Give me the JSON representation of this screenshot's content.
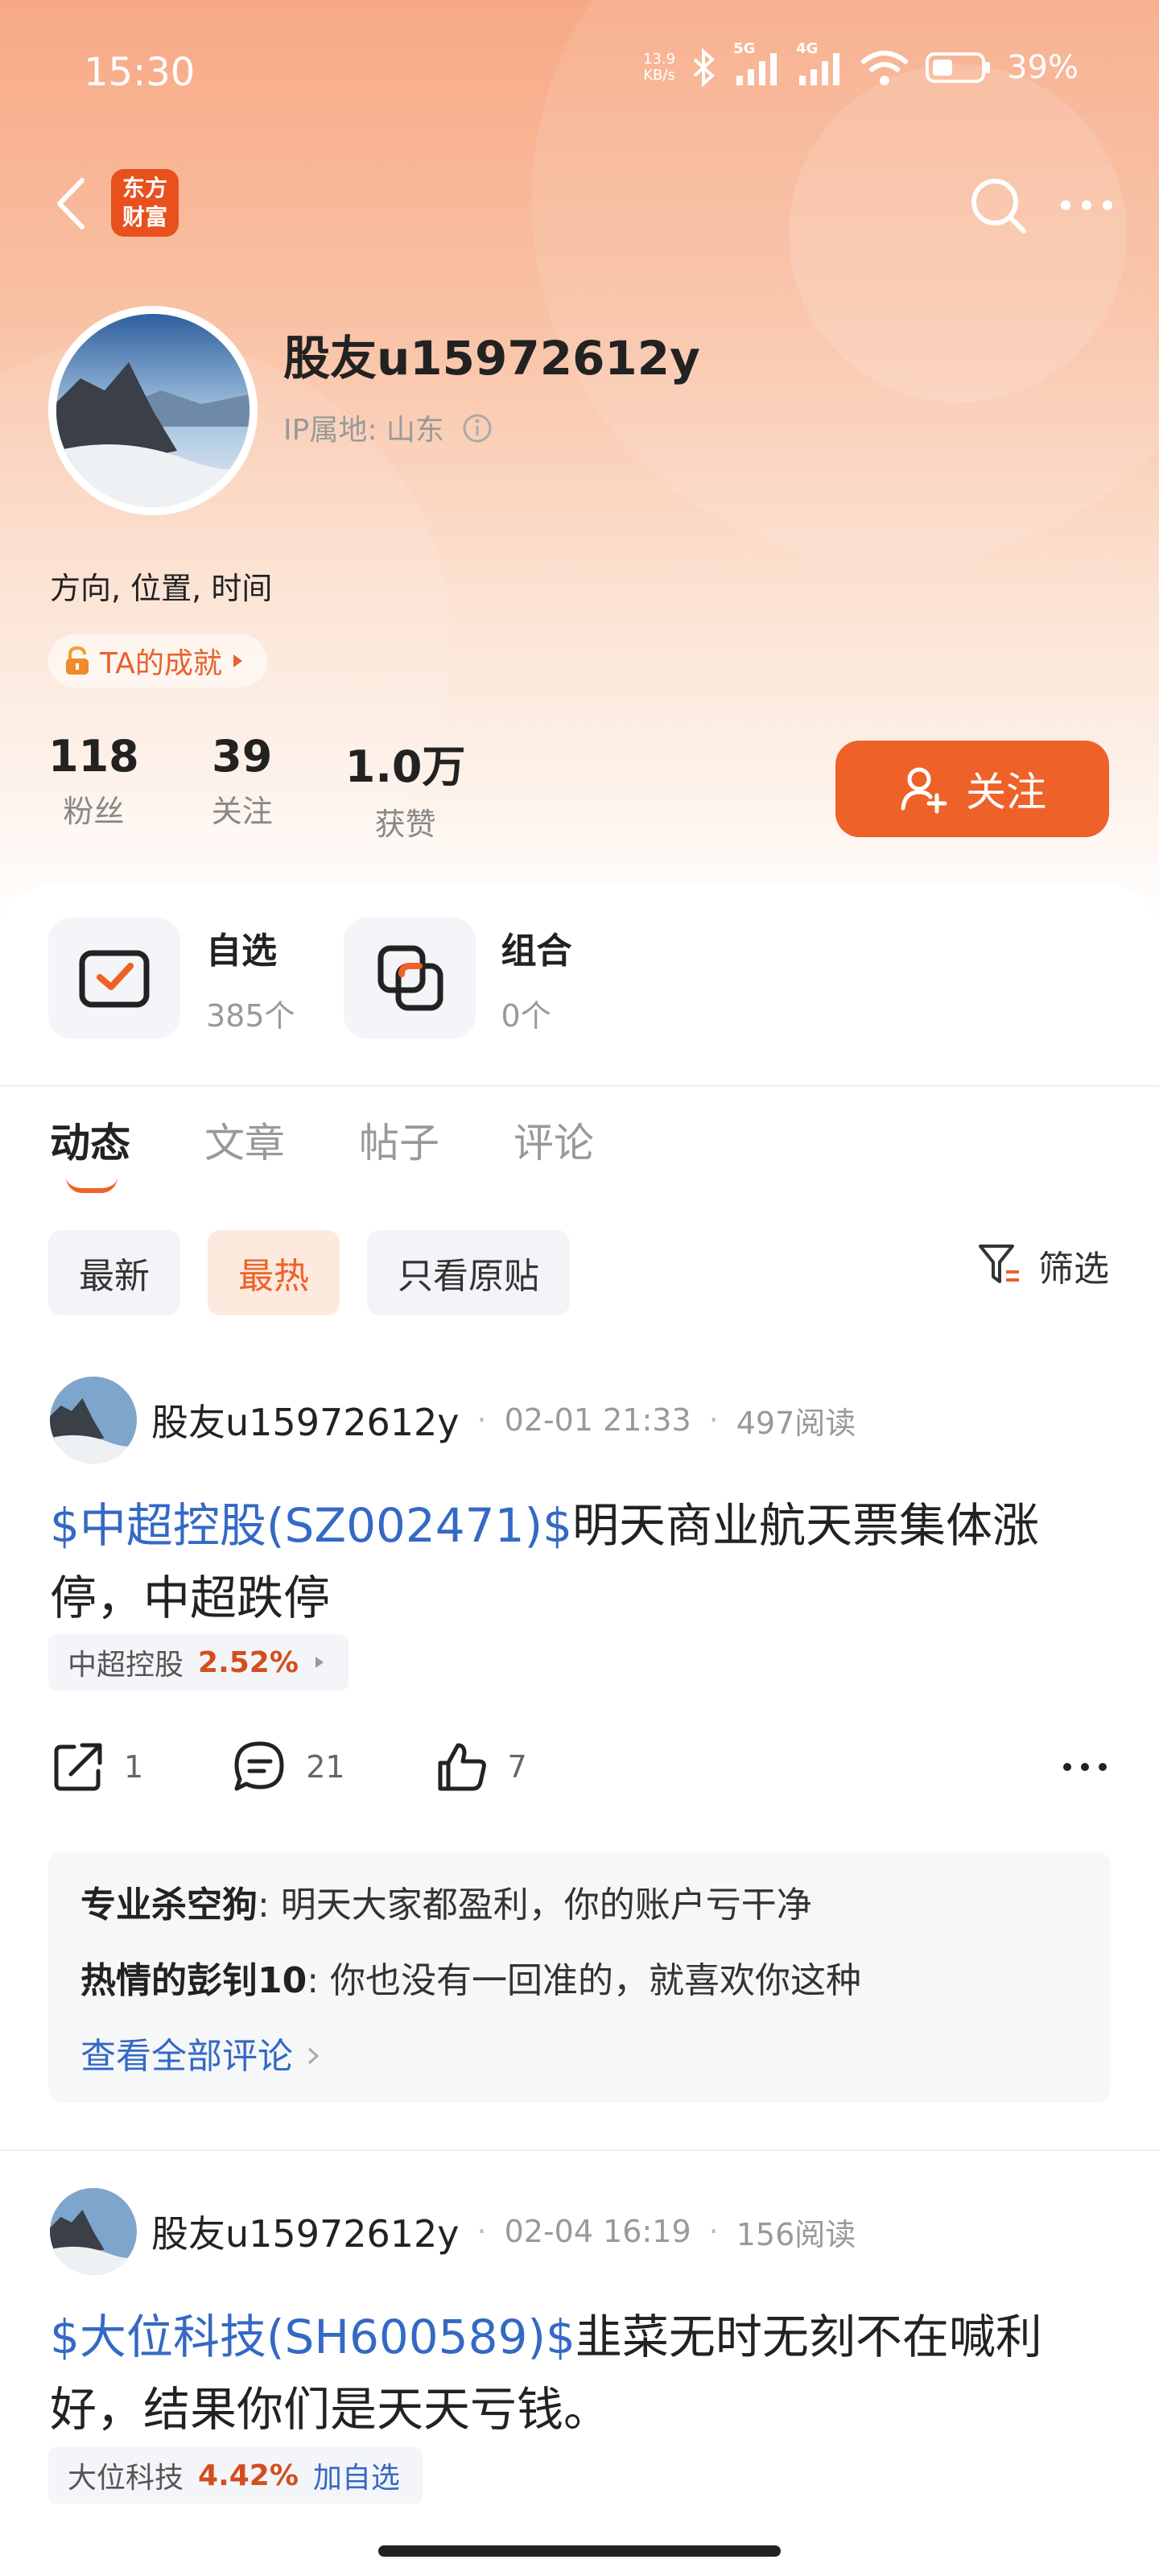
{
  "status_bar": {
    "time": "15:30",
    "net_speed_value": "13.9",
    "net_speed_unit": "KB/s",
    "sig1": "5G",
    "sig2": "4G",
    "battery": "39%"
  },
  "nav": {
    "logo_line1": "东方",
    "logo_line2": "财富"
  },
  "profile": {
    "username": "股友u15972612y",
    "ip_location": "IP属地: 山东",
    "bio": "方向, 位置, 时间",
    "achievement": "TA的成就",
    "stats": [
      {
        "value": "118",
        "label": "粉丝"
      },
      {
        "value": "39",
        "label": "关注"
      },
      {
        "value": "1.0万",
        "label": "获赞"
      }
    ],
    "follow_label": "关注"
  },
  "quick": [
    {
      "title": "自选",
      "sub": "385个"
    },
    {
      "title": "组合",
      "sub": "0个"
    }
  ],
  "tabs": [
    "动态",
    "文章",
    "帖子",
    "评论"
  ],
  "filters": [
    "最新",
    "最热",
    "只看原贴"
  ],
  "screen_label": "筛选",
  "posts": [
    {
      "author": "股友u15972612y",
      "time": "02-01 21:33",
      "reads": "497阅读",
      "link": "$中超控股(SZ002471)$",
      "text": "明天商业航天票集体涨停，中超跌停",
      "tag_name": "中超控股",
      "tag_pct": "2.52%",
      "share": "1",
      "comments": "21",
      "likes": "7",
      "comment_list": [
        {
          "user": "专业杀空狗",
          "text": ": 明天大家都盈利，你的账户亏干净"
        },
        {
          "user": "热情的彭钊10",
          "text": ": 你也没有一回准的，就喜欢你这种"
        }
      ],
      "see_all": "查看全部评论"
    },
    {
      "author": "股友u15972612y",
      "time": "02-04 16:19",
      "reads": "156阅读",
      "link": "$大位科技(SH600589)$",
      "text": "韭菜无时无刻不在喊利好，结果你们是天天亏钱。",
      "tag_name": "大位科技",
      "tag_pct": "4.42%",
      "tag_add": "加自选"
    }
  ],
  "colors": {
    "accent": "#ee6129",
    "link": "#3469c4",
    "up_red": "#d34e1e"
  }
}
